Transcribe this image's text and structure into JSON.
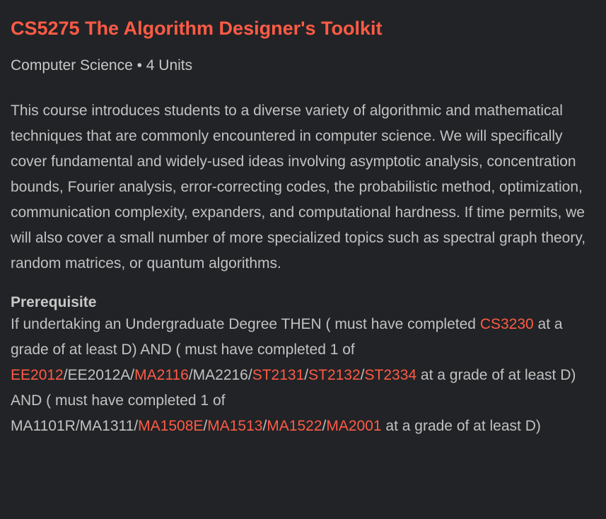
{
  "course": {
    "title": "CS5275 The Algorithm Designer's Toolkit",
    "meta": "Computer Science • 4 Units",
    "description": "This course introduces students to a diverse variety of algorithmic and mathematical techniques that are commonly encountered in computer science. We will specifically cover fundamental and widely-used ideas involving asymptotic analysis, concentration bounds, Fourier analysis, error-correcting codes, the probabilistic method, optimization, communication complexity, expanders, and computational hardness. If time permits, we will also cover a small number of more specialized topics such as spectral graph theory, random matrices, or quantum algorithms."
  },
  "prerequisite": {
    "heading": "Prerequisite",
    "text_1": "If undertaking an Undergraduate Degree THEN ( must have completed ",
    "link_cs3230": "CS3230",
    "text_2": " at a grade of at least D) AND ( must have completed 1 of ",
    "link_ee2012": "EE2012",
    "text_ee2012a": "/EE2012A/",
    "link_ma2116": "MA2116",
    "text_ma2216": "/MA2216/",
    "link_st2131": "ST2131",
    "sep_1": "/",
    "link_st2132": "ST2132",
    "sep_2": "/",
    "link_st2334": "ST2334",
    "text_3": " at a grade of at least D) AND ( must have completed 1 of MA1101R/MA1311/",
    "link_ma1508e": "MA1508E",
    "sep_3": "/",
    "link_ma1513": "MA1513",
    "sep_4": "/",
    "link_ma1522": "MA1522",
    "sep_5": "/",
    "link_ma2001": "MA2001",
    "text_4": " at a grade of at least D)"
  },
  "colors": {
    "background": "#222326",
    "accent": "#ff5b45",
    "text": "#c2c2c2"
  }
}
